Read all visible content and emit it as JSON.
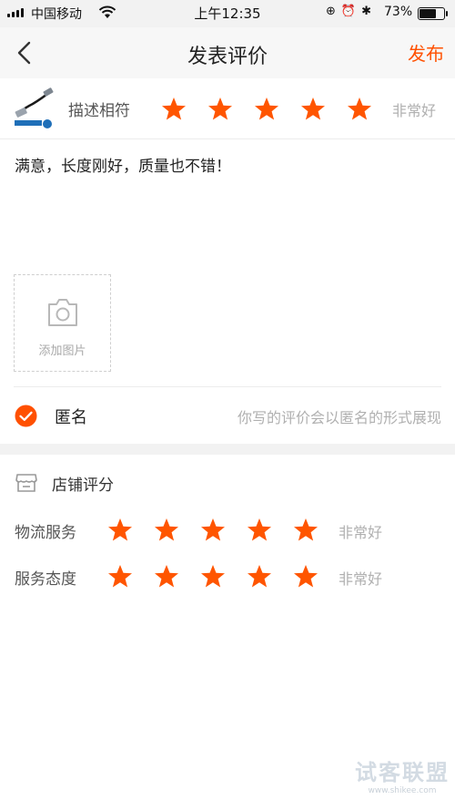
{
  "status_bar": {
    "carrier": "中国移动",
    "time": "上午12:35",
    "battery": "73%",
    "battery_level": 0.73,
    "icons": [
      "signal-icon",
      "wifi-icon",
      "orientation-lock-icon",
      "alarm-icon",
      "bluetooth-icon",
      "battery-icon"
    ]
  },
  "nav": {
    "title": "发表评价",
    "publish_label": "发布",
    "back_icon": "back-chevron-icon"
  },
  "product_rating": {
    "label": "描述相符",
    "stars": 5,
    "max_stars": 5,
    "rating_text": "非常好"
  },
  "review": {
    "text": "满意，长度刚好，质量也不错！"
  },
  "photo": {
    "add_label": "添加图片",
    "icon": "camera-icon"
  },
  "anonymous": {
    "label": "匿名",
    "checked": true,
    "hint": "你写的评价会以匿名的形式展现"
  },
  "store": {
    "title": "店铺评分",
    "icon": "store-icon",
    "ratings": [
      {
        "label": "物流服务",
        "stars": 5,
        "rating_text": "非常好"
      },
      {
        "label": "服务态度",
        "stars": 5,
        "rating_text": "非常好"
      }
    ]
  },
  "watermark": {
    "main": "试客联盟",
    "url": "www.shikee.com"
  },
  "colors": {
    "accent": "#ff5000",
    "star": "#ff5500",
    "hint_text": "#b0b0b0",
    "divider_bg": "#f2f2f2"
  }
}
